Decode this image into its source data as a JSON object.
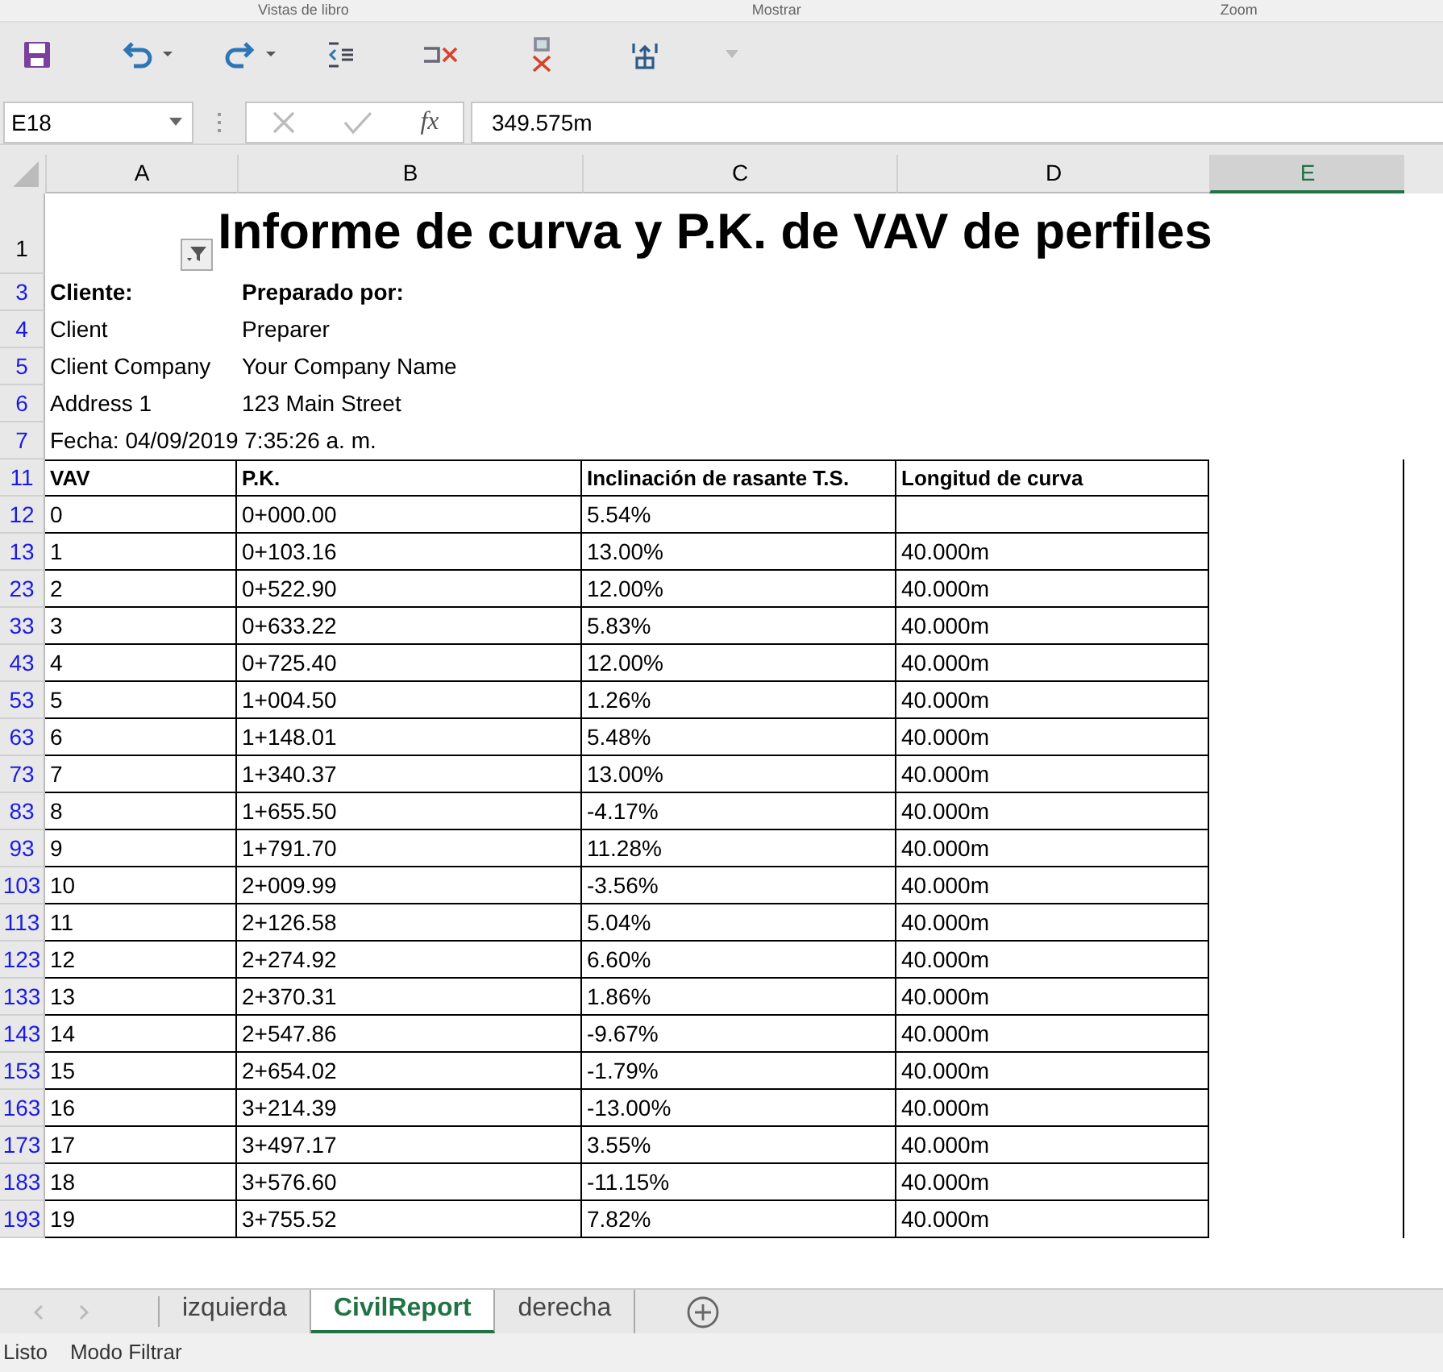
{
  "ribbon": {
    "group_labels": [
      "Vistas de libro",
      "Mostrar",
      "Zoom"
    ]
  },
  "formula_bar": {
    "name_box": "E18",
    "function_label": "fx",
    "value": "349.575m"
  },
  "columns": [
    {
      "label": "A",
      "selected": false
    },
    {
      "label": "B",
      "selected": false
    },
    {
      "label": "C",
      "selected": false
    },
    {
      "label": "D",
      "selected": false
    },
    {
      "label": "E",
      "selected": true
    }
  ],
  "title_row": {
    "number": "1",
    "filtered": false,
    "title": "Informe de curva y P.K. de VAV de perfiles"
  },
  "info_rows": [
    {
      "number": "3",
      "filtered": true,
      "kind": "heading",
      "cells": [
        "Cliente:",
        "Preparado por:"
      ]
    },
    {
      "number": "4",
      "filtered": true,
      "kind": "plain",
      "cells": [
        "Client",
        "Preparer"
      ]
    },
    {
      "number": "5",
      "filtered": true,
      "kind": "plain",
      "cells": [
        "Client Company",
        "Your Company Name"
      ]
    },
    {
      "number": "6",
      "filtered": true,
      "kind": "plain",
      "cells": [
        "Address 1",
        "123 Main Street"
      ]
    },
    {
      "number": "7",
      "filtered": true,
      "kind": "plain",
      "cells": [
        "Fecha: 04/09/2019 7:35:26 a. m."
      ]
    }
  ],
  "table": {
    "header": {
      "number": "11",
      "filtered": true,
      "cells": [
        "VAV",
        "P.K.",
        "Inclinación de rasante T.S.",
        "Longitud de curva"
      ]
    },
    "rows": [
      {
        "number": "12",
        "filtered": true,
        "cells": [
          "0",
          "0+000.00",
          "5.54%",
          ""
        ]
      },
      {
        "number": "13",
        "filtered": true,
        "cells": [
          "1",
          "0+103.16",
          "13.00%",
          "40.000m"
        ]
      },
      {
        "number": "23",
        "filtered": true,
        "cells": [
          "2",
          "0+522.90",
          "12.00%",
          "40.000m"
        ]
      },
      {
        "number": "33",
        "filtered": true,
        "cells": [
          "3",
          "0+633.22",
          "5.83%",
          "40.000m"
        ]
      },
      {
        "number": "43",
        "filtered": true,
        "cells": [
          "4",
          "0+725.40",
          "12.00%",
          "40.000m"
        ]
      },
      {
        "number": "53",
        "filtered": true,
        "cells": [
          "5",
          "1+004.50",
          "1.26%",
          "40.000m"
        ]
      },
      {
        "number": "63",
        "filtered": true,
        "cells": [
          "6",
          "1+148.01",
          "5.48%",
          "40.000m"
        ]
      },
      {
        "number": "73",
        "filtered": true,
        "cells": [
          "7",
          "1+340.37",
          "13.00%",
          "40.000m"
        ]
      },
      {
        "number": "83",
        "filtered": true,
        "cells": [
          "8",
          "1+655.50",
          "-4.17%",
          "40.000m"
        ]
      },
      {
        "number": "93",
        "filtered": true,
        "cells": [
          "9",
          "1+791.70",
          "11.28%",
          "40.000m"
        ]
      },
      {
        "number": "103",
        "filtered": true,
        "cells": [
          "10",
          "2+009.99",
          "-3.56%",
          "40.000m"
        ]
      },
      {
        "number": "113",
        "filtered": true,
        "cells": [
          "11",
          "2+126.58",
          "5.04%",
          "40.000m"
        ]
      },
      {
        "number": "123",
        "filtered": true,
        "cells": [
          "12",
          "2+274.92",
          "6.60%",
          "40.000m"
        ]
      },
      {
        "number": "133",
        "filtered": true,
        "cells": [
          "13",
          "2+370.31",
          "1.86%",
          "40.000m"
        ]
      },
      {
        "number": "143",
        "filtered": true,
        "cells": [
          "14",
          "2+547.86",
          "-9.67%",
          "40.000m"
        ]
      },
      {
        "number": "153",
        "filtered": true,
        "cells": [
          "15",
          "2+654.02",
          "-1.79%",
          "40.000m"
        ]
      },
      {
        "number": "163",
        "filtered": true,
        "cells": [
          "16",
          "3+214.39",
          "-13.00%",
          "40.000m"
        ]
      },
      {
        "number": "173",
        "filtered": true,
        "cells": [
          "17",
          "3+497.17",
          "3.55%",
          "40.000m"
        ]
      },
      {
        "number": "183",
        "filtered": true,
        "cells": [
          "18",
          "3+576.60",
          "-11.15%",
          "40.000m"
        ]
      },
      {
        "number": "193",
        "filtered": true,
        "cells": [
          "19",
          "3+755.52",
          "7.82%",
          "40.000m"
        ]
      }
    ]
  },
  "sheet_tabs": [
    {
      "label": "izquierda",
      "selected": false
    },
    {
      "label": "CivilReport",
      "selected": true
    },
    {
      "label": "derecha",
      "selected": false
    }
  ],
  "status_bar": [
    "Listo",
    "Modo Filtrar"
  ]
}
